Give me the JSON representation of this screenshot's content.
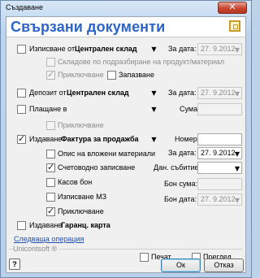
{
  "window": {
    "title": "Създаване",
    "close_symbol": "✕"
  },
  "header": {
    "title": "Свързани документи"
  },
  "issue_from": {
    "label": "Изписване от",
    "value": "Централен склад",
    "date_label": "За дата:",
    "date": "27. 9.2012",
    "checked": false
  },
  "stock_by_subtracking": {
    "label": "Складове по подразбиране на продукт/материал",
    "checked": false
  },
  "issue_completion": {
    "label": "Приключване",
    "checked": true
  },
  "issue_reserve": {
    "label": "Запазване",
    "checked": false
  },
  "deposit_to": {
    "label": "Депозит от",
    "value": "Централен склад",
    "date_label": "За дата:",
    "date": "27. 9.2012",
    "checked": false
  },
  "payment_in": {
    "label": "Плащане в",
    "amount_label": "Сума:",
    "checked": false
  },
  "payment_completion": {
    "label": "Приключване",
    "checked": false
  },
  "issuance": {
    "label": "Издаване",
    "value": "Фактура за продажба",
    "number_label": "Номер:",
    "date_label": "За дата:",
    "date": "27. 9.2012",
    "checked": true
  },
  "issuance_options": [
    {
      "label": "Опис на вложени материали",
      "checked": false
    },
    {
      "label": "Счетоводно записване",
      "checked": true
    },
    {
      "label": "Касов бон",
      "checked": false
    },
    {
      "label": "Изписване МЗ",
      "checked": false
    },
    {
      "label": "Приключване",
      "checked": true
    }
  ],
  "tax_event": {
    "label": "Дан. събитие:"
  },
  "receipt_amount": {
    "label": "Бон сума:"
  },
  "receipt_date": {
    "label": "Бон дата:",
    "value": "27. 9.2012"
  },
  "issuance_card": {
    "label": "Издаване",
    "value": "Гаранц. карта",
    "checked": false
  },
  "next_operation_link": "Следваща операция",
  "company_label": "Unicontsoft ®",
  "print": {
    "label": "Печат",
    "checked": false
  },
  "preview": {
    "label": "Преглед",
    "checked": false
  },
  "buttons": {
    "ok": "Ок",
    "cancel": "Отказ",
    "help": "?"
  },
  "icons": {
    "dropdown": "▼",
    "checkbox": "checkbox-icon",
    "header": "related-documents-icon"
  },
  "colors": {
    "accent": "#2d64c8",
    "link": "#1f4fb5",
    "close": "#c9452f"
  }
}
